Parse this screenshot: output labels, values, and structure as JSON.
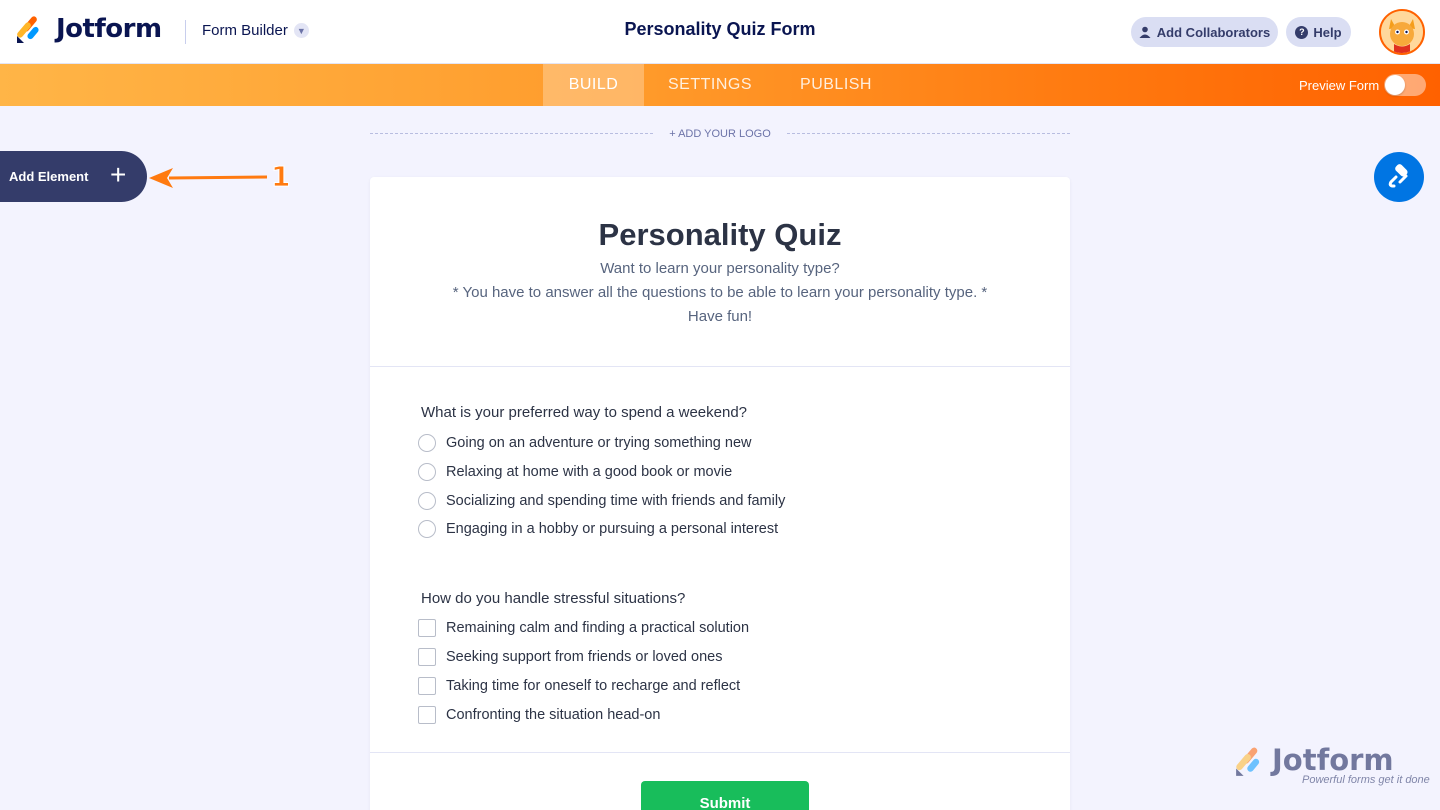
{
  "header": {
    "logo_text": "Jotform",
    "builder_dropdown": "Form Builder",
    "form_title": "Personality Quiz Form",
    "collaborators_button": "Add Collaborators",
    "help_button": "Help"
  },
  "nav": {
    "tabs": [
      {
        "label": "BUILD",
        "active": true
      },
      {
        "label": "SETTINGS",
        "active": false
      },
      {
        "label": "PUBLISH",
        "active": false
      }
    ],
    "preview_label": "Preview Form",
    "preview_on": false
  },
  "canvas": {
    "add_logo": "+ ADD YOUR LOGO",
    "add_element": "Add Element",
    "annotation_number": "1"
  },
  "form": {
    "heading": "Personality Quiz",
    "subheading_lines": [
      "Want to learn your personality type?",
      "* You have to answer all the questions to be able to learn your personality type. *",
      "Have fun!"
    ],
    "questions": [
      {
        "label": "What is your preferred way to spend a weekend?",
        "type": "radio",
        "options": [
          "Going on an adventure or trying something new",
          "Relaxing at home with a good book or movie",
          "Socializing and spending time with friends and family",
          "Engaging in a hobby or pursuing a personal interest"
        ]
      },
      {
        "label": "How do you handle stressful situations?",
        "type": "checkbox",
        "options": [
          "Remaining calm and finding a practical solution",
          "Seeking support from friends or loved ones",
          "Taking time for oneself to recharge and reflect",
          "Confronting the situation head-on"
        ]
      }
    ],
    "submit_label": "Submit"
  },
  "watermark": {
    "title": "Jotform",
    "tagline": "Powerful forms get it done"
  },
  "colors": {
    "brand_orange": "#ff6100",
    "navy": "#0a1551",
    "submit_green": "#18bd5b",
    "designer_blue": "#0075e3"
  }
}
